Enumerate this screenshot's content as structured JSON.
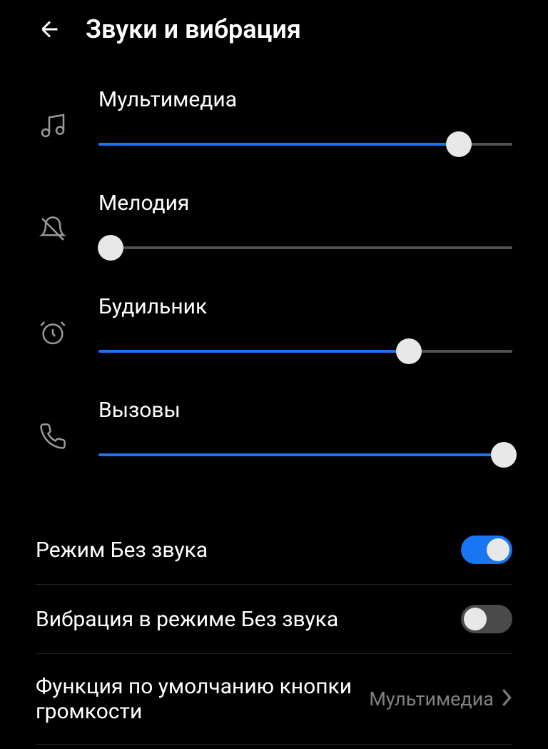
{
  "header": {
    "title": "Звуки и вибрация"
  },
  "sliders": {
    "media": {
      "label": "Мультимедиа",
      "value": 87
    },
    "ringtone": {
      "label": "Мелодия",
      "value": 0
    },
    "alarm": {
      "label": "Будильник",
      "value": 75
    },
    "calls": {
      "label": "Вызовы",
      "value": 100
    }
  },
  "settings": {
    "silent_mode": {
      "label": "Режим Без звука",
      "enabled": true
    },
    "vibrate_silent": {
      "label": "Вибрация в режиме Без звука",
      "enabled": false
    },
    "default_volume_button": {
      "label": "Функция по умолчанию кнопки громкости",
      "value": "Мультимедиа"
    }
  },
  "colors": {
    "accent": "#1976f2",
    "background": "#000000",
    "text": "#ffffff",
    "text_secondary": "#808080",
    "track": "#515151"
  }
}
